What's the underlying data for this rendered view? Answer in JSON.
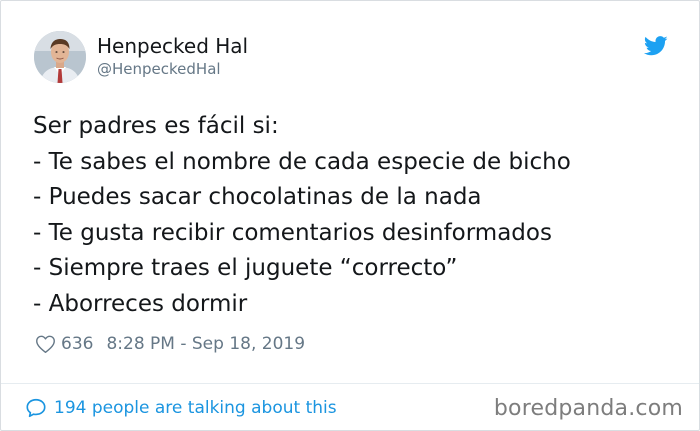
{
  "user": {
    "name": "Henpecked Hal",
    "handle": "@HenpeckedHal"
  },
  "tweet": {
    "lines": [
      "Ser padres es fácil si:",
      "- Te sabes el nombre de cada especie de bicho",
      "- Puedes sacar chocolatinas de la nada",
      "- Te gusta recibir comentarios desinformados",
      "- Siempre traes el juguete “correcto”",
      "- Aborreces dormir"
    ]
  },
  "meta": {
    "likes": "636",
    "timestamp": "8:28 PM - Sep 18, 2019"
  },
  "footer": {
    "talking": "194 people are talking about this"
  },
  "watermark": "boredpanda.com",
  "colors": {
    "twitter_blue": "#1da1f2",
    "link_blue": "#1b95e0",
    "muted_gray": "#657786"
  },
  "icons": {
    "brand": "twitter-bird-icon",
    "like": "heart-icon",
    "reply": "comment-bubble-icon"
  }
}
